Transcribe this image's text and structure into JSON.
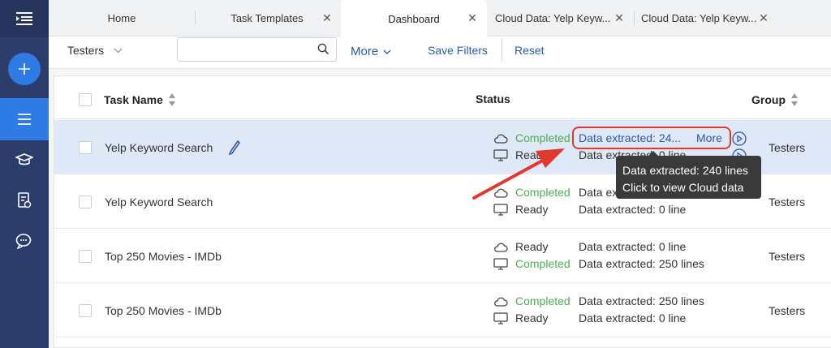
{
  "tabs": [
    {
      "label": "Home",
      "closable": false,
      "active": false
    },
    {
      "label": "Task Templates",
      "closable": true,
      "active": false
    },
    {
      "label": "Dashboard",
      "closable": true,
      "active": true
    },
    {
      "label": "Cloud Data: Yelp Keyw...",
      "closable": true,
      "active": false
    },
    {
      "label": "Cloud Data: Yelp Keyw...",
      "closable": true,
      "active": false
    }
  ],
  "filter": {
    "group_selected": "Testers",
    "search_value": "",
    "more_label": "More",
    "save_filters_label": "Save Filters",
    "reset_label": "Reset"
  },
  "table": {
    "headers": {
      "task_name": "Task Name",
      "status": "Status",
      "group": "Group"
    },
    "rows": [
      {
        "name": "Yelp Keyword Search",
        "cloud_status": "Completed",
        "cloud_data": "Data extracted: 24...",
        "cloud_more": "More",
        "local_status": "Ready",
        "local_data": "Data extracted: 0 line",
        "group": "Testers"
      },
      {
        "name": "Yelp Keyword Search",
        "cloud_status": "Completed",
        "cloud_data": "Data extracted: 240 lines",
        "local_status": "Ready",
        "local_data": "Data extracted: 0 line",
        "group": "Testers"
      },
      {
        "name": "Top 250 Movies - IMDb",
        "cloud_status": "Ready",
        "cloud_data": "Data extracted: 0 line",
        "local_status": "Completed",
        "local_data": "Data extracted: 250 lines",
        "group": "Testers"
      },
      {
        "name": "Top 250 Movies - IMDb",
        "cloud_status": "Completed",
        "cloud_data": "Data extracted: 250 lines",
        "local_status": "Ready",
        "local_data": "Data extracted: 0 line",
        "group": "Testers"
      }
    ]
  },
  "tooltip": {
    "line1": "Data extracted: 240 lines",
    "line2": "Click to view Cloud data"
  },
  "colors": {
    "sidebar": "#2d3d6b",
    "accent": "#2f7be5",
    "completed": "#4caf50",
    "link": "#2b5aa8",
    "annotation": "#e03a2f"
  },
  "icons": [
    "menu-icon",
    "plus-icon",
    "list-icon",
    "graduation-cap-icon",
    "document-check-icon",
    "chat-icon",
    "search-icon",
    "cloud-icon",
    "monitor-icon",
    "pencil-icon",
    "play-circle-icon",
    "sort-icon",
    "close-icon",
    "chevron-down-icon"
  ]
}
